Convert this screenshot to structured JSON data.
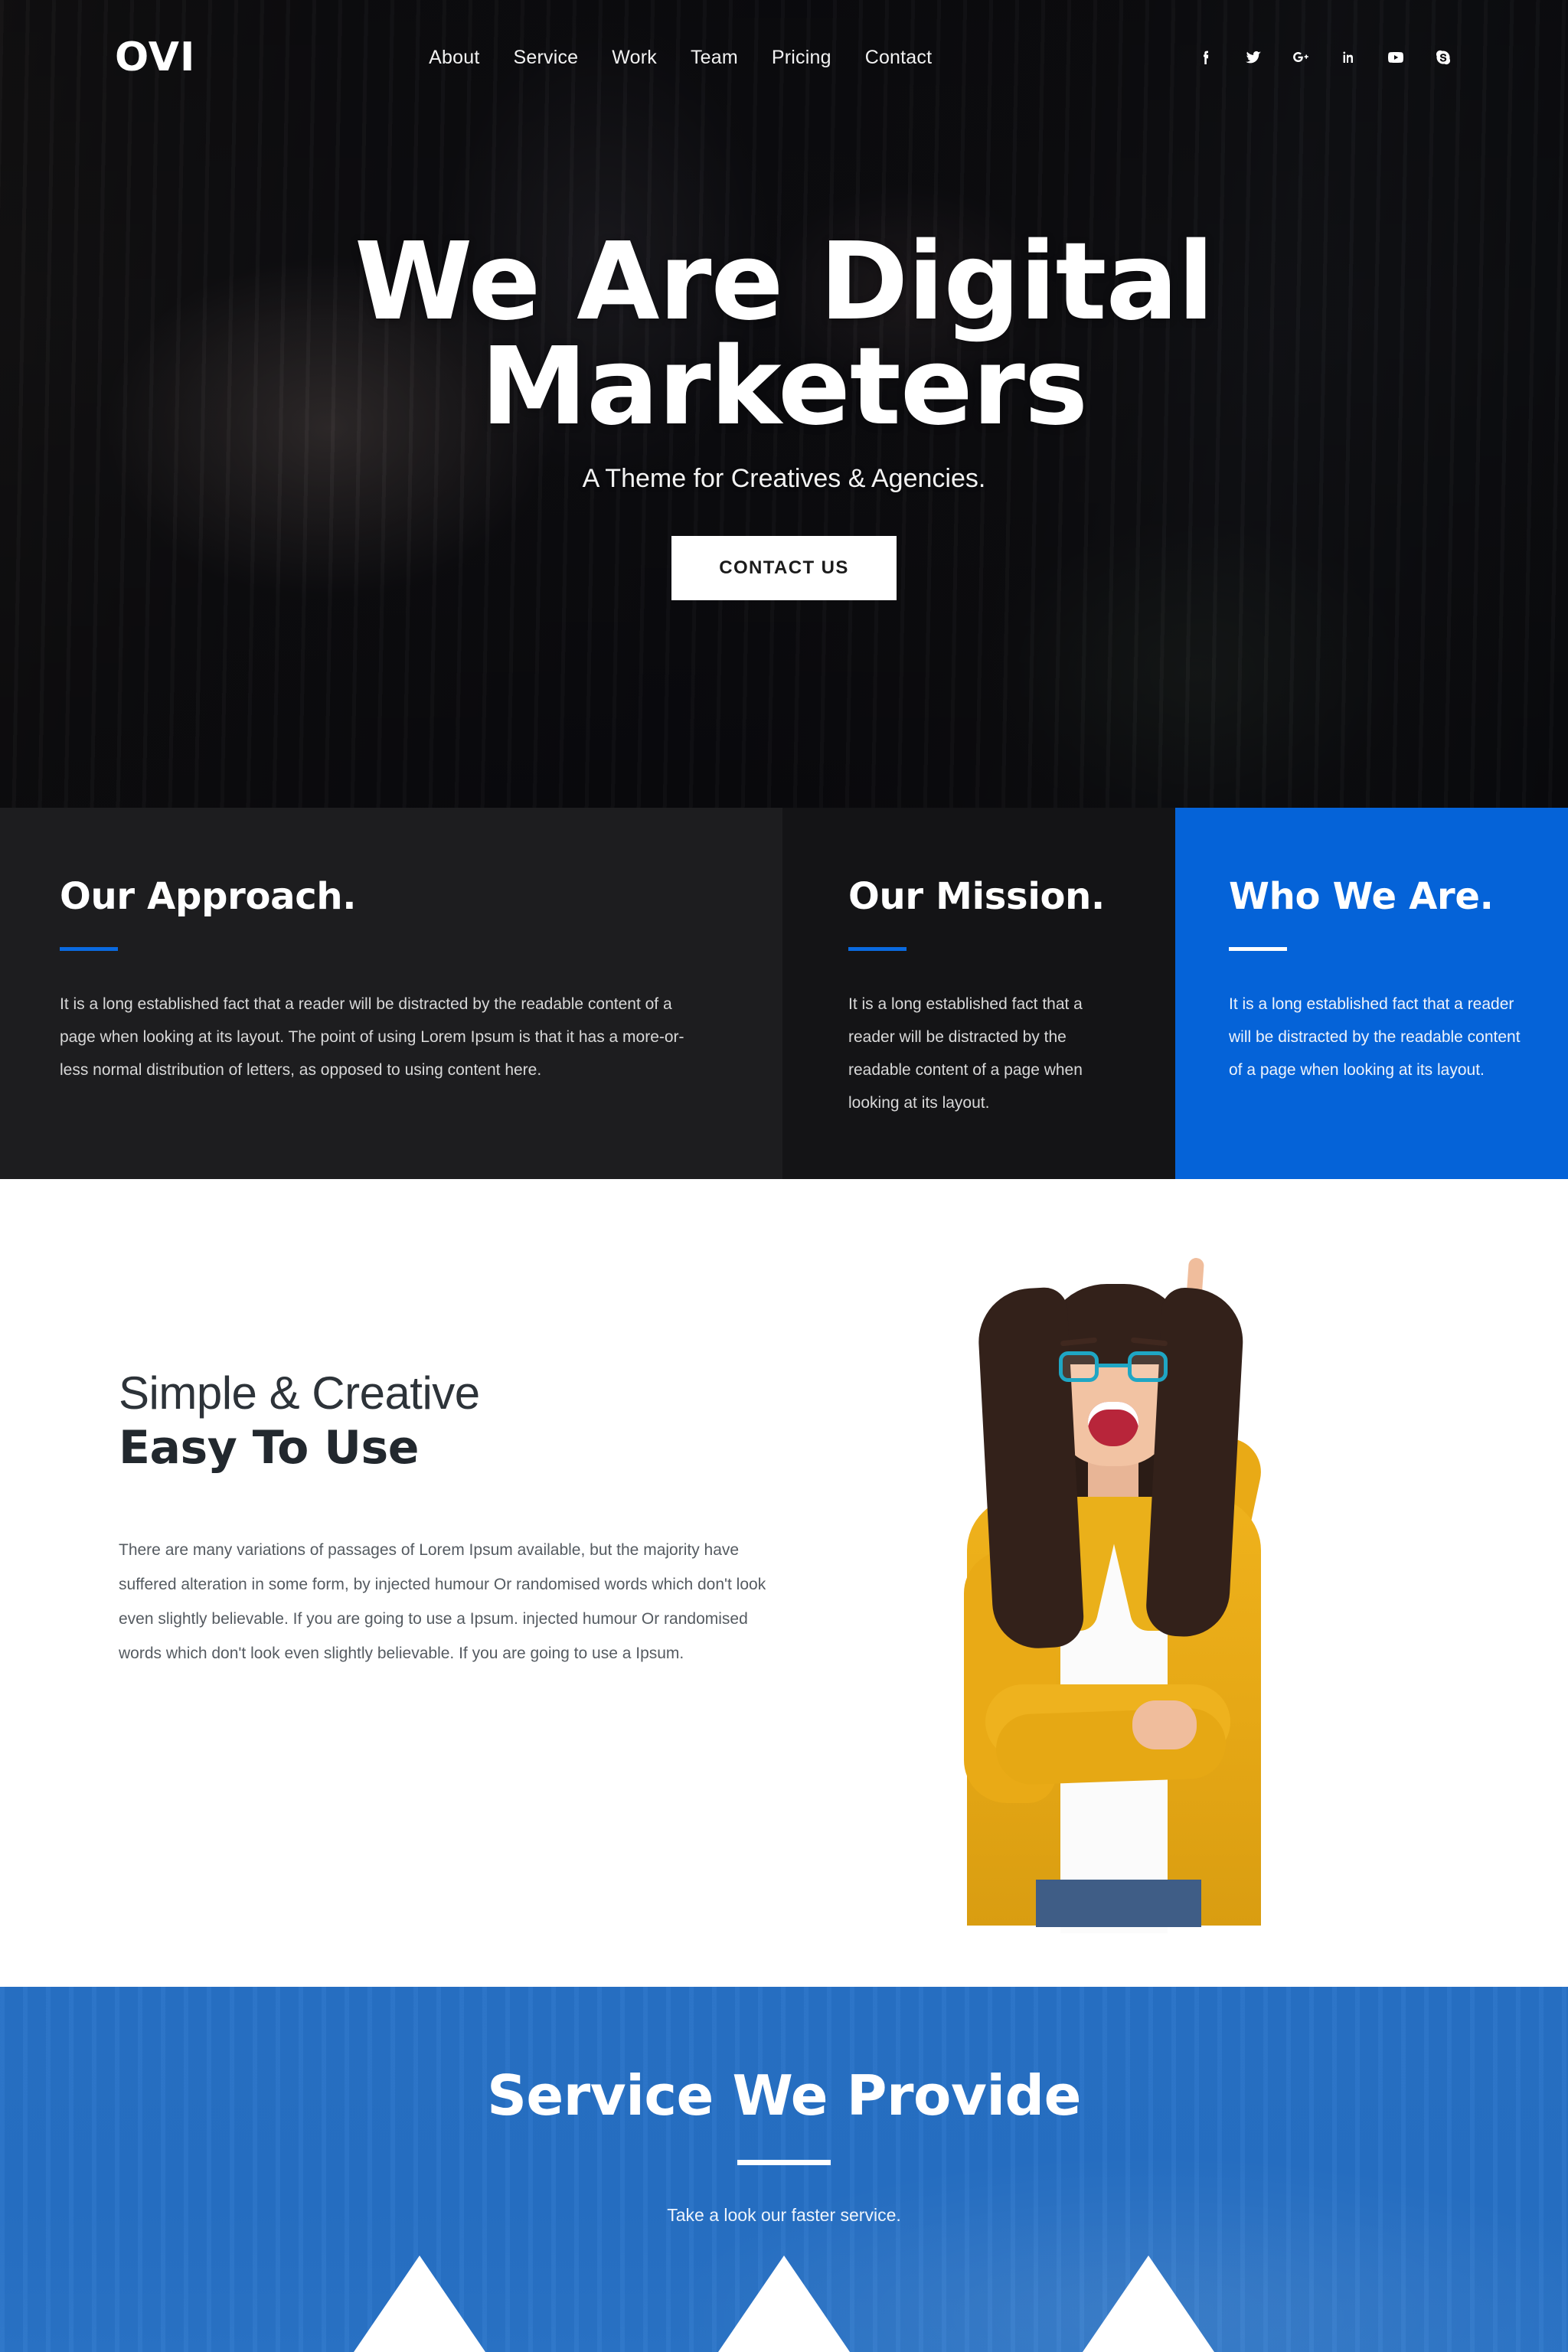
{
  "brand": {
    "name": "OVI"
  },
  "nav": {
    "items": [
      {
        "label": "About"
      },
      {
        "label": "Service"
      },
      {
        "label": "Work"
      },
      {
        "label": "Team"
      },
      {
        "label": "Pricing"
      },
      {
        "label": "Contact"
      }
    ]
  },
  "socials": [
    {
      "name": "facebook-icon"
    },
    {
      "name": "twitter-icon"
    },
    {
      "name": "google-plus-icon"
    },
    {
      "name": "linkedin-icon"
    },
    {
      "name": "youtube-icon"
    },
    {
      "name": "skype-icon"
    }
  ],
  "hero": {
    "title_line1": "We Are Digital",
    "title_line2": "Marketers",
    "subtitle": "A Theme for Creatives & Agencies.",
    "cta_label": "CONTACT US"
  },
  "stripe": {
    "approach": {
      "heading": "Our Approach.",
      "body": "It is a long established fact that a reader will be distracted by the readable content of a page when looking at its layout. The point of using Lorem Ipsum is that it has a more-or-less normal distribution of letters, as opposed to using content here."
    },
    "mission": {
      "heading": "Our Mission.",
      "body": "It is a long established fact that a reader will be distracted by the readable content of a page when looking at its layout."
    },
    "who": {
      "heading": "Who We Are.",
      "body": "It is a long established fact that a reader will be distracted by the readable content of a page when looking at its layout."
    }
  },
  "easy": {
    "heading_light": "Simple & Creative",
    "heading_bold": "Easy To Use",
    "body": "There are many variations of passages of Lorem Ipsum available, but the majority have suffered alteration in some form, by injected humour Or randomised words which don't look even slightly believable. If you are going to use a Ipsum. injected humour Or randomised words which don't look even slightly believable. If you are going to use a Ipsum."
  },
  "service": {
    "heading": "Service We Provide",
    "subtitle": "Take a look our faster service."
  },
  "colors": {
    "accent_blue": "#0563d8",
    "section_blue": "#2670c5",
    "dark_panel": "#1d1d1f",
    "dark_panel_alt": "#141416"
  }
}
